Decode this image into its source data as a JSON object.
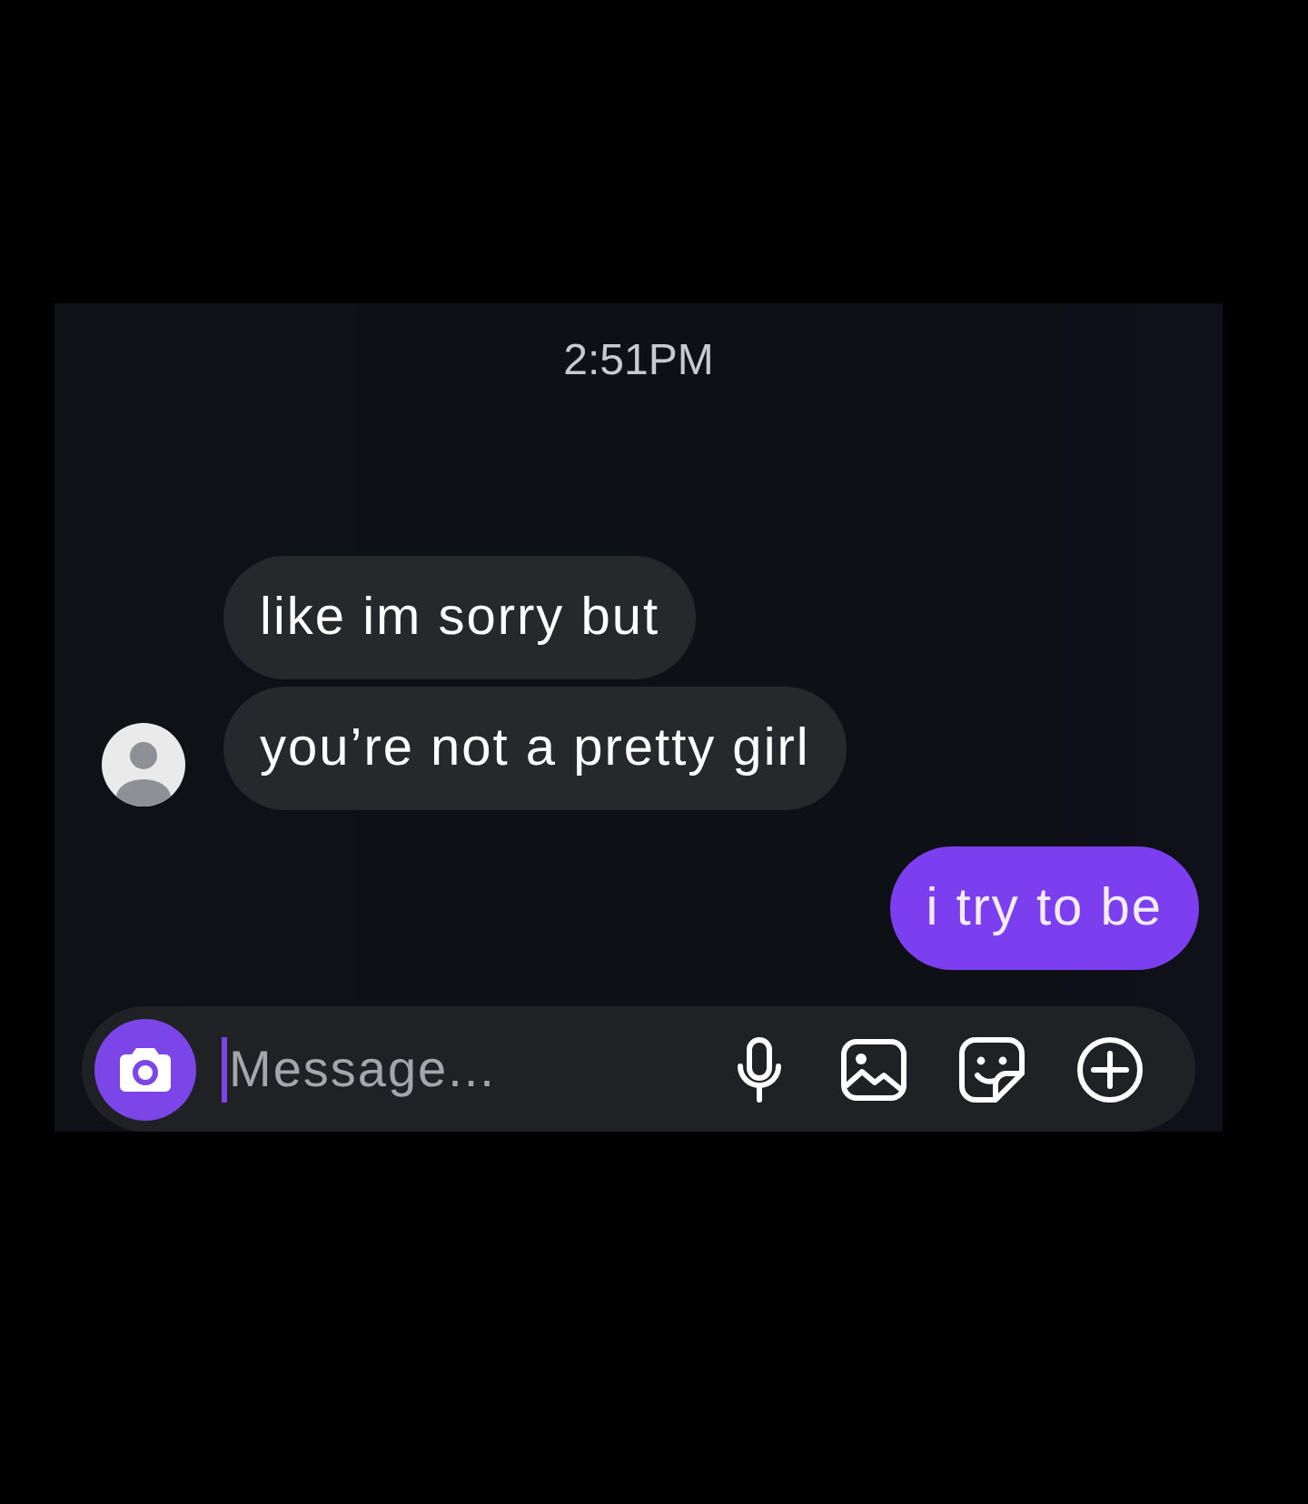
{
  "timestamp": "2:51PM",
  "messages": [
    {
      "kind": "incoming",
      "text": "like im sorry but",
      "avatar": false
    },
    {
      "kind": "incoming",
      "text": "you’re not a pretty girl",
      "avatar": true
    },
    {
      "kind": "outgoing",
      "text": "i try to be"
    }
  ],
  "composer": {
    "placeholder": "Message..."
  }
}
